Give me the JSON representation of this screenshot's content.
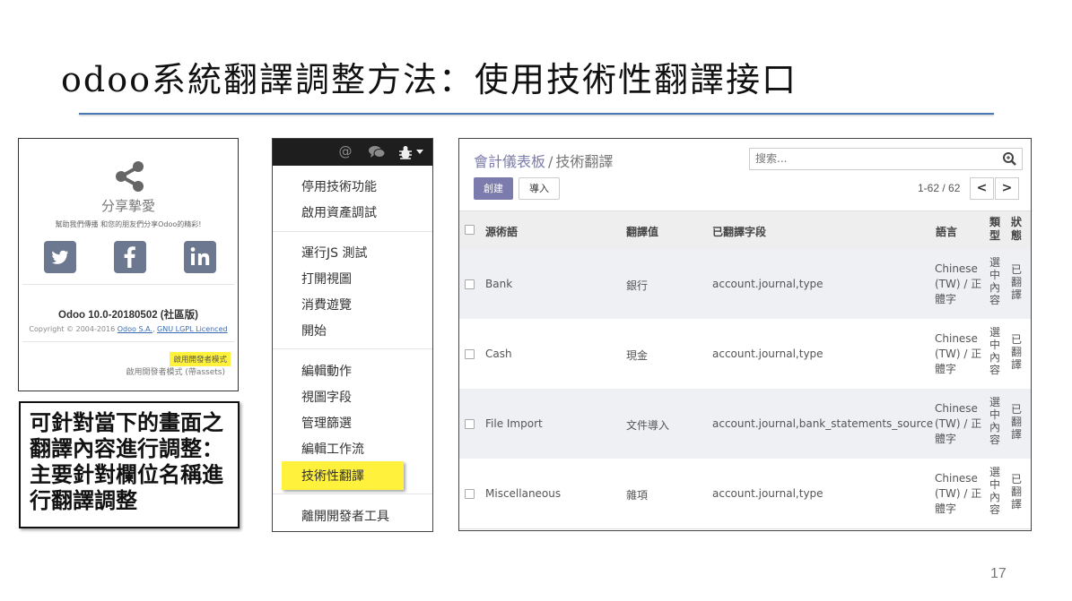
{
  "slide": {
    "title": "odoo系統翻譯調整方法：使用技術性翻譯接口",
    "page_number": "17",
    "note": "可針對當下的畫面之翻譯內容進行調整：主要針對欄位名稱進行翻譯調整"
  },
  "about": {
    "share_heading": "分享摯愛",
    "share_desc": "幫助我們傳播 和您的朋友們分享Odoo的精彩!",
    "social": [
      {
        "name": "twitter",
        "icon": "twitter-icon",
        "glyph": "🐦"
      },
      {
        "name": "facebook",
        "icon": "facebook-icon",
        "glyph": "f"
      },
      {
        "name": "linkedin",
        "icon": "linkedin-icon",
        "glyph": "in"
      }
    ],
    "version": "Odoo 10.0-20180502 (社區版)",
    "copyright_prefix": "Copyright © 2004-2016 ",
    "copyright_company": "Odoo S.A.",
    "copyright_license": "GNU LGPL Licenced",
    "dev_mode_label": "啟用開發者模式",
    "dev_mode_assets_label": "啟用開發者模式 (帶assets)",
    "highlight_color": "#fff13c",
    "social_color": "#6c7790"
  },
  "debug_menu": {
    "icons": [
      "at-icon",
      "chat-icon",
      "bug-icon",
      "caret-down-icon"
    ],
    "at_glyph": "@",
    "groups": [
      [
        "停用技術功能",
        "啟用資產調試"
      ],
      [
        "運行JS 測試",
        "打開視圖",
        "消費遊覽",
        "開始"
      ],
      [
        "編輯動作",
        "視圖字段",
        "管理篩選",
        "編輯工作流",
        "技術性翻譯"
      ],
      [
        "離開開發者工具"
      ]
    ],
    "highlighted_item": "技術性翻譯"
  },
  "translations": {
    "breadcrumb_parent": "會計儀表板",
    "breadcrumb_sep": "/",
    "breadcrumb_current": "技術翻譯",
    "search_placeholder": "搜索...",
    "create_label": "創建",
    "import_label": "導入",
    "pager": "1-62 / 62",
    "pager_prev": "<",
    "pager_next": ">",
    "brand_color": "#7c7bad",
    "columns": {
      "source": "源術語",
      "value": "翻譯值",
      "field": "已翻譯字段",
      "lang": "語言",
      "type": "類型",
      "state": "狀態"
    },
    "rows": [
      {
        "source": "Bank",
        "value": "銀行",
        "field": "account.journal,type",
        "lang": "Chinese (TW) / 正體字",
        "type": "選中內容",
        "state": "已翻譯"
      },
      {
        "source": "Cash",
        "value": "現金",
        "field": "account.journal,type",
        "lang": "Chinese (TW) / 正體字",
        "type": "選中內容",
        "state": "已翻譯"
      },
      {
        "source": "File Import",
        "value": "文件導入",
        "field": "account.journal,bank_statements_source",
        "lang": "Chinese (TW) / 正體字",
        "type": "選中內容",
        "state": "已翻譯"
      },
      {
        "source": "Miscellaneous",
        "value": "雜項",
        "field": "account.journal,type",
        "lang": "Chinese (TW) / 正體字",
        "type": "選中內容",
        "state": "已翻譯"
      }
    ]
  }
}
